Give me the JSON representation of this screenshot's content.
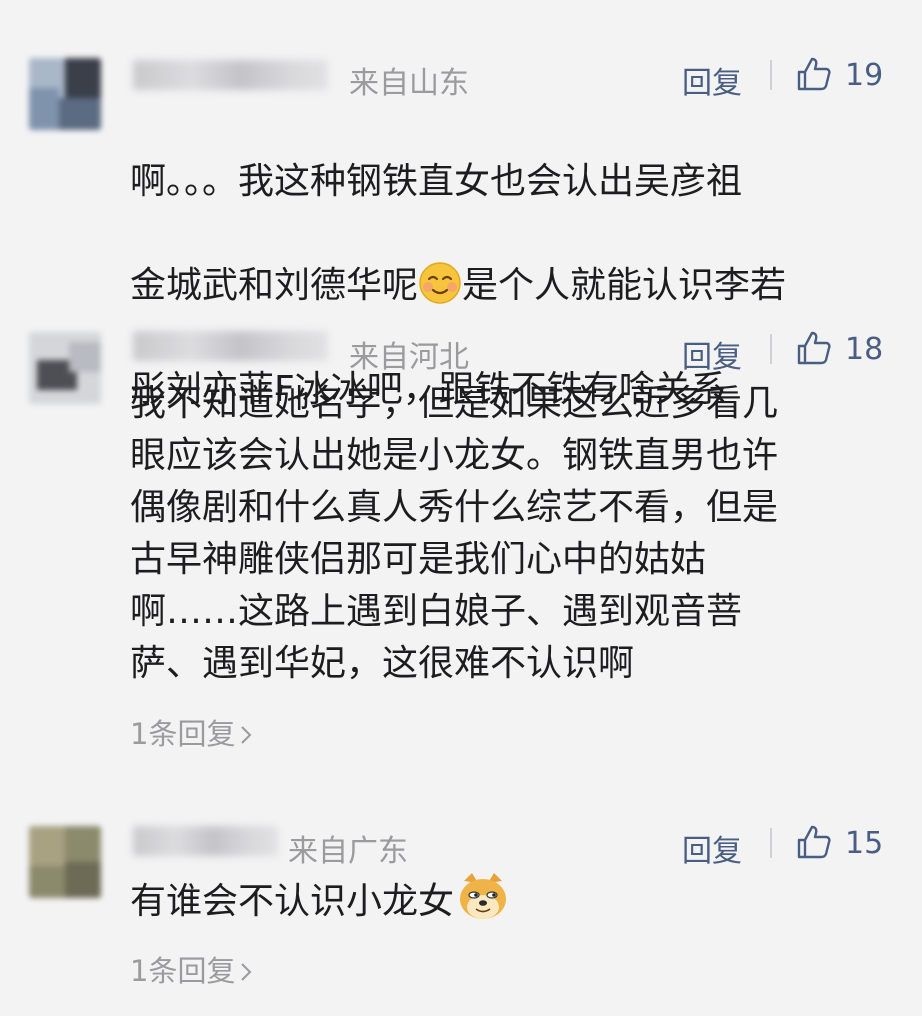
{
  "reply_label": "回复",
  "comments": [
    {
      "region": "来自山东",
      "likes": "19",
      "text_line1": "啊。。。我这种钢铁直女也会认出吴彦祖",
      "text_line2_a": "金城武和刘德华呢",
      "emoji_a": "smiling-face-emoji",
      "text_line2_b": "是个人就能认识李若",
      "text_line3": "彤刘亦菲F冰冰吧，跟铁不铁有啥关系"
    },
    {
      "region": "来自河北",
      "likes": "18",
      "text": "我不知道她名字，但是如果这么近多看几\n眼应该会认出她是小龙女。钢铁直男也许\n偶像剧和什么真人秀什么综艺不看，但是\n古早神雕侠侣那可是我们心中的姑姑\n啊……这路上遇到白娘子、遇到观音菩\n萨、遇到华妃，这很难不认识啊",
      "sub_replies": "1条回复"
    },
    {
      "region": "来自广东",
      "likes": "15",
      "text": "有谁会不认识小龙女",
      "emoji": "doge-emoji",
      "sub_replies": "1条回复"
    }
  ],
  "colors": {
    "background": "#f3f3f4",
    "text": "#1d1d1f",
    "meta": "#9a9a9f",
    "action": "#4a5d82"
  }
}
